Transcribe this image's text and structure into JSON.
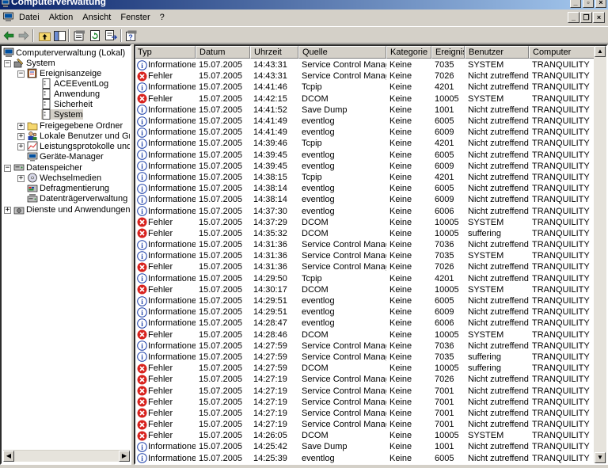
{
  "window": {
    "title": "Computerverwaltung",
    "menu": [
      "Datei",
      "Aktion",
      "Ansicht",
      "Fenster",
      "?"
    ]
  },
  "toolbar": {
    "icons": [
      "back-icon",
      "forward-icon",
      "up-folder-icon",
      "show-tree-icon",
      "properties-icon",
      "refresh-icon",
      "export-icon",
      "help-icon"
    ]
  },
  "tree": {
    "root": "Computerverwaltung (Lokal)",
    "system": "System",
    "ereignisanzeige": "Ereignisanzeige",
    "ace": "ACEEventLog",
    "anwendung": "Anwendung",
    "sicherheit": "Sicherheit",
    "system_log": "System",
    "freigegebene": "Freigegebene Ordner",
    "lokale": "Lokale Benutzer und Gruppen",
    "leistung": "Leistungsprotokolle und Warnungen",
    "geraete": "Geräte-Manager",
    "datenspeicher": "Datenspeicher",
    "wechselmedien": "Wechselmedien",
    "defrag": "Defragmentierung",
    "datentraeger": "Datenträgerverwaltung",
    "dienste": "Dienste und Anwendungen"
  },
  "columns": [
    "Typ",
    "Datum",
    "Uhrzeit",
    "Quelle",
    "Kategorie",
    "Ereignis",
    "Benutzer",
    "Computer"
  ],
  "colors": {
    "info": "#1c3fa8",
    "error": "#d8231f",
    "title_start": "#0a246a",
    "title_end": "#a6caf0"
  },
  "events": [
    [
      "info",
      "Informationen",
      "15.07.2005",
      "14:43:31",
      "Service Control Manager",
      "Keine",
      "7035",
      "SYSTEM",
      "TRANQUILITY"
    ],
    [
      "error",
      "Fehler",
      "15.07.2005",
      "14:43:31",
      "Service Control Manager",
      "Keine",
      "7026",
      "Nicht zutreffend",
      "TRANQUILITY"
    ],
    [
      "info",
      "Informationen",
      "15.07.2005",
      "14:41:46",
      "Tcpip",
      "Keine",
      "4201",
      "Nicht zutreffend",
      "TRANQUILITY"
    ],
    [
      "error",
      "Fehler",
      "15.07.2005",
      "14:42:15",
      "DCOM",
      "Keine",
      "10005",
      "SYSTEM",
      "TRANQUILITY"
    ],
    [
      "info",
      "Informationen",
      "15.07.2005",
      "14:41:52",
      "Save Dump",
      "Keine",
      "1001",
      "Nicht zutreffend",
      "TRANQUILITY"
    ],
    [
      "info",
      "Informationen",
      "15.07.2005",
      "14:41:49",
      "eventlog",
      "Keine",
      "6005",
      "Nicht zutreffend",
      "TRANQUILITY"
    ],
    [
      "info",
      "Informationen",
      "15.07.2005",
      "14:41:49",
      "eventlog",
      "Keine",
      "6009",
      "Nicht zutreffend",
      "TRANQUILITY"
    ],
    [
      "info",
      "Informationen",
      "15.07.2005",
      "14:39:46",
      "Tcpip",
      "Keine",
      "4201",
      "Nicht zutreffend",
      "TRANQUILITY"
    ],
    [
      "info",
      "Informationen",
      "15.07.2005",
      "14:39:45",
      "eventlog",
      "Keine",
      "6005",
      "Nicht zutreffend",
      "TRANQUILITY"
    ],
    [
      "info",
      "Informationen",
      "15.07.2005",
      "14:39:45",
      "eventlog",
      "Keine",
      "6009",
      "Nicht zutreffend",
      "TRANQUILITY"
    ],
    [
      "info",
      "Informationen",
      "15.07.2005",
      "14:38:15",
      "Tcpip",
      "Keine",
      "4201",
      "Nicht zutreffend",
      "TRANQUILITY"
    ],
    [
      "info",
      "Informationen",
      "15.07.2005",
      "14:38:14",
      "eventlog",
      "Keine",
      "6005",
      "Nicht zutreffend",
      "TRANQUILITY"
    ],
    [
      "info",
      "Informationen",
      "15.07.2005",
      "14:38:14",
      "eventlog",
      "Keine",
      "6009",
      "Nicht zutreffend",
      "TRANQUILITY"
    ],
    [
      "info",
      "Informationen",
      "15.07.2005",
      "14:37:30",
      "eventlog",
      "Keine",
      "6006",
      "Nicht zutreffend",
      "TRANQUILITY"
    ],
    [
      "error",
      "Fehler",
      "15.07.2005",
      "14:37:29",
      "DCOM",
      "Keine",
      "10005",
      "SYSTEM",
      "TRANQUILITY"
    ],
    [
      "error",
      "Fehler",
      "15.07.2005",
      "14:35:32",
      "DCOM",
      "Keine",
      "10005",
      "suffering",
      "TRANQUILITY"
    ],
    [
      "info",
      "Informationen",
      "15.07.2005",
      "14:31:36",
      "Service Control Manager",
      "Keine",
      "7036",
      "Nicht zutreffend",
      "TRANQUILITY"
    ],
    [
      "info",
      "Informationen",
      "15.07.2005",
      "14:31:36",
      "Service Control Manager",
      "Keine",
      "7035",
      "SYSTEM",
      "TRANQUILITY"
    ],
    [
      "error",
      "Fehler",
      "15.07.2005",
      "14:31:36",
      "Service Control Manager",
      "Keine",
      "7026",
      "Nicht zutreffend",
      "TRANQUILITY"
    ],
    [
      "info",
      "Informationen",
      "15.07.2005",
      "14:29:50",
      "Tcpip",
      "Keine",
      "4201",
      "Nicht zutreffend",
      "TRANQUILITY"
    ],
    [
      "error",
      "Fehler",
      "15.07.2005",
      "14:30:17",
      "DCOM",
      "Keine",
      "10005",
      "SYSTEM",
      "TRANQUILITY"
    ],
    [
      "info",
      "Informationen",
      "15.07.2005",
      "14:29:51",
      "eventlog",
      "Keine",
      "6005",
      "Nicht zutreffend",
      "TRANQUILITY"
    ],
    [
      "info",
      "Informationen",
      "15.07.2005",
      "14:29:51",
      "eventlog",
      "Keine",
      "6009",
      "Nicht zutreffend",
      "TRANQUILITY"
    ],
    [
      "info",
      "Informationen",
      "15.07.2005",
      "14:28:47",
      "eventlog",
      "Keine",
      "6006",
      "Nicht zutreffend",
      "TRANQUILITY"
    ],
    [
      "error",
      "Fehler",
      "15.07.2005",
      "14:28:46",
      "DCOM",
      "Keine",
      "10005",
      "SYSTEM",
      "TRANQUILITY"
    ],
    [
      "info",
      "Informationen",
      "15.07.2005",
      "14:27:59",
      "Service Control Manager",
      "Keine",
      "7036",
      "Nicht zutreffend",
      "TRANQUILITY"
    ],
    [
      "info",
      "Informationen",
      "15.07.2005",
      "14:27:59",
      "Service Control Manager",
      "Keine",
      "7035",
      "suffering",
      "TRANQUILITY"
    ],
    [
      "error",
      "Fehler",
      "15.07.2005",
      "14:27:59",
      "DCOM",
      "Keine",
      "10005",
      "suffering",
      "TRANQUILITY"
    ],
    [
      "error",
      "Fehler",
      "15.07.2005",
      "14:27:19",
      "Service Control Manager",
      "Keine",
      "7026",
      "Nicht zutreffend",
      "TRANQUILITY"
    ],
    [
      "error",
      "Fehler",
      "15.07.2005",
      "14:27:19",
      "Service Control Manager",
      "Keine",
      "7001",
      "Nicht zutreffend",
      "TRANQUILITY"
    ],
    [
      "error",
      "Fehler",
      "15.07.2005",
      "14:27:19",
      "Service Control Manager",
      "Keine",
      "7001",
      "Nicht zutreffend",
      "TRANQUILITY"
    ],
    [
      "error",
      "Fehler",
      "15.07.2005",
      "14:27:19",
      "Service Control Manager",
      "Keine",
      "7001",
      "Nicht zutreffend",
      "TRANQUILITY"
    ],
    [
      "error",
      "Fehler",
      "15.07.2005",
      "14:27:19",
      "Service Control Manager",
      "Keine",
      "7001",
      "Nicht zutreffend",
      "TRANQUILITY"
    ],
    [
      "error",
      "Fehler",
      "15.07.2005",
      "14:26:05",
      "DCOM",
      "Keine",
      "10005",
      "SYSTEM",
      "TRANQUILITY"
    ],
    [
      "info",
      "Informationen",
      "15.07.2005",
      "14:25:42",
      "Save Dump",
      "Keine",
      "1001",
      "Nicht zutreffend",
      "TRANQUILITY"
    ],
    [
      "info",
      "Informationen",
      "15.07.2005",
      "14:25:39",
      "eventlog",
      "Keine",
      "6005",
      "Nicht zutreffend",
      "TRANQUILITY"
    ]
  ]
}
